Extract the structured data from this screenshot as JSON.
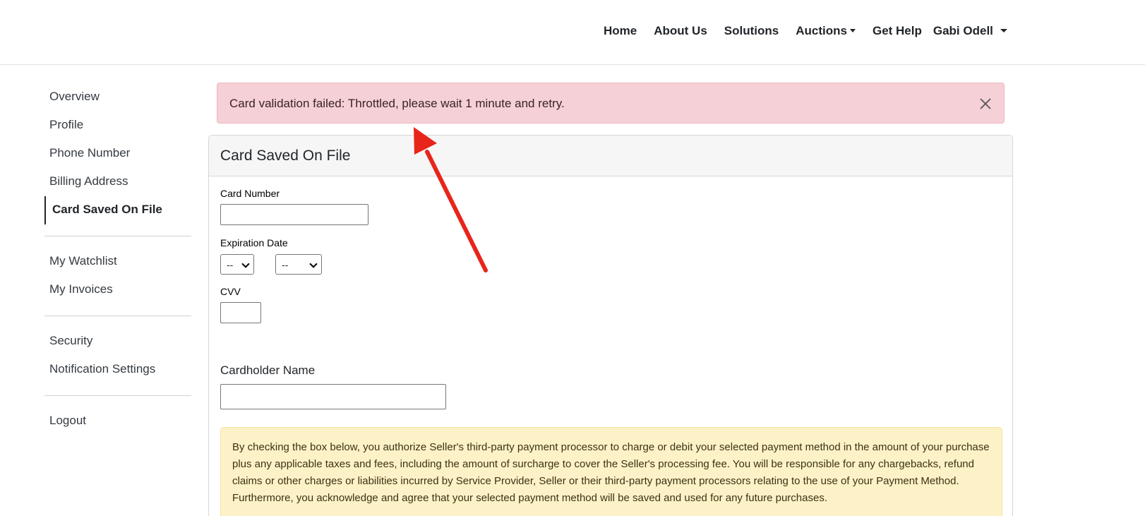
{
  "nav": {
    "items": [
      "Home",
      "About Us",
      "Solutions"
    ],
    "auctions": "Auctions",
    "help": "Get Help",
    "user": "Gabi Odell"
  },
  "sidebar": {
    "group1": [
      "Overview",
      "Profile",
      "Phone Number",
      "Billing Address",
      "Card Saved On File"
    ],
    "group2": [
      "My Watchlist",
      "My Invoices"
    ],
    "group3": [
      "Security",
      "Notification Settings"
    ],
    "group4": [
      "Logout"
    ],
    "active": "Card Saved On File"
  },
  "alert": {
    "message": "Card validation failed: Throttled, please wait 1 minute and retry.",
    "close_icon": "close-icon"
  },
  "card": {
    "title": "Card Saved On File",
    "card_number_label": "Card Number",
    "card_number_value": "",
    "expiration_label": "Expiration Date",
    "exp_month_value": "--",
    "exp_year_value": "--",
    "cvv_label": "CVV",
    "cvv_value": "",
    "cardholder_label": "Cardholder Name",
    "cardholder_value": "",
    "disclaimer": "By checking the box below, you authorize Seller's third-party payment processor to charge or debit your selected payment method in the amount of your purchase plus any applicable taxes and fees, including the amount of surcharge to cover the Seller's processing fee. You will be responsible for any chargebacks, refund claims or other charges or liabilities incurred by Service Provider, Seller or their third-party payment processors relating to the use of your Payment Method. Furthermore, you acknowledge and agree that your selected payment method will be saved and used for any future purchases."
  },
  "colors": {
    "danger_bg": "#f5d0d6",
    "warning_bg": "#fdf2c7",
    "annotation_arrow": "#e8251a"
  }
}
